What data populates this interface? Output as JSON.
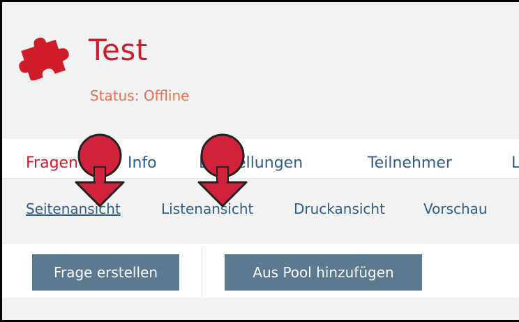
{
  "app": {
    "title": "Test",
    "status": "Status: Offline",
    "logo_icon": "puzzle-piece-icon",
    "brand_color": "#d01b2b"
  },
  "tabs": [
    {
      "label": "Fragen",
      "active": true
    },
    {
      "label": "Info",
      "active": false
    },
    {
      "label": "Einstellungen",
      "active": false
    },
    {
      "label": "Teilnehmer",
      "active": false
    },
    {
      "label": "L",
      "active": false
    }
  ],
  "subtabs": [
    {
      "label": "Seitenansicht",
      "active": true
    },
    {
      "label": "Listenansicht",
      "active": false
    },
    {
      "label": "Druckansicht",
      "active": false
    },
    {
      "label": "Vorschau",
      "active": false
    }
  ],
  "toolbar": {
    "create_question_label": "Frage erstellen",
    "add_from_pool_label": "Aus Pool hinzufügen"
  },
  "annotations": {
    "marker_icon": "arrow-pin-down-icon",
    "marker_color": "#d0233b"
  }
}
